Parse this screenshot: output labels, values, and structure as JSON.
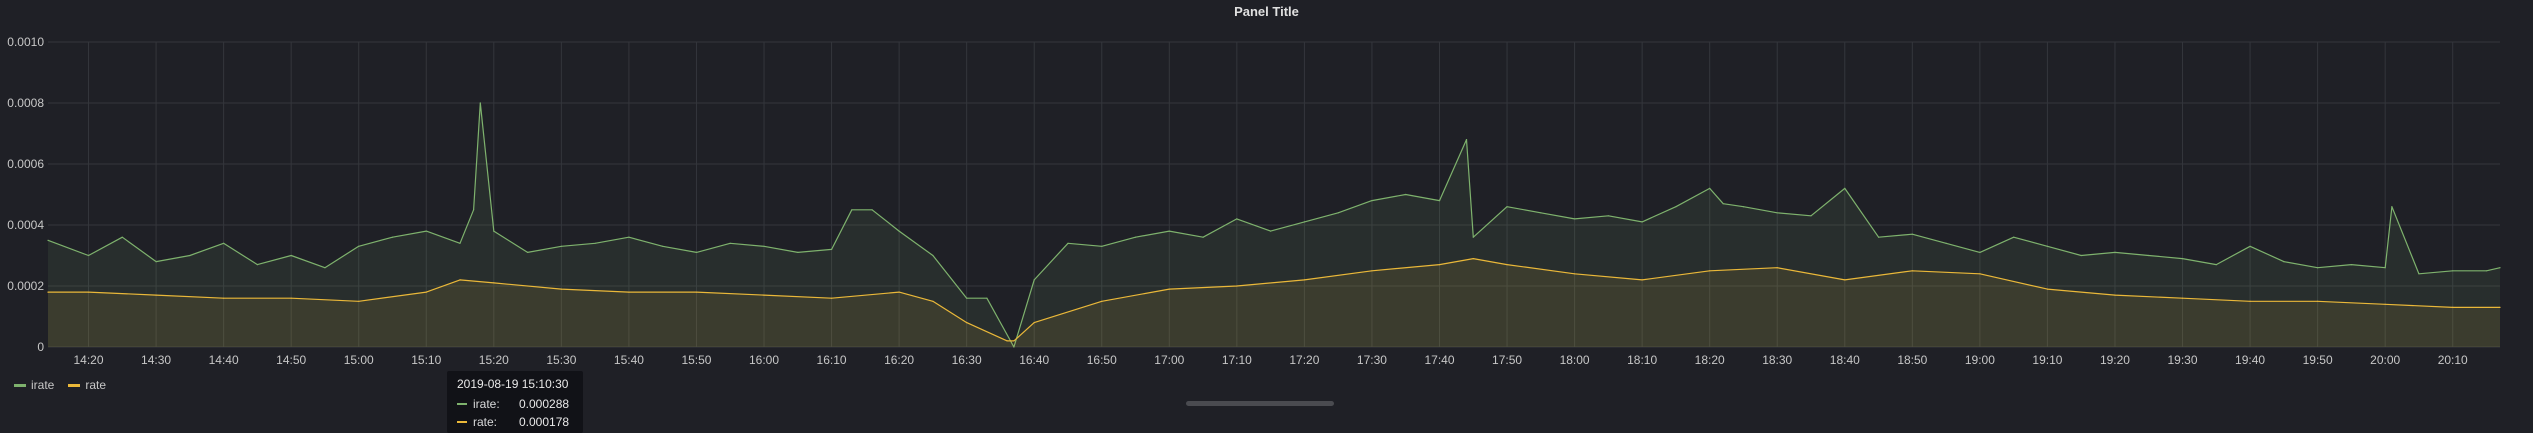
{
  "panel": {
    "title": "Panel Title"
  },
  "tooltip": {
    "time": "2019-08-19 15:10:30",
    "rows": [
      {
        "name": "irate:",
        "value": "0.000288",
        "color": "#7eb26d"
      },
      {
        "name": "rate:",
        "value": "0.000178",
        "color": "#eab839"
      }
    ]
  },
  "chart_data": {
    "type": "line",
    "title": "Panel Title",
    "xlabel": "",
    "ylabel": "",
    "x_domain": [
      "14:14",
      "20:17"
    ],
    "ylim": [
      0,
      0.001
    ],
    "yticks": [
      0,
      0.0002,
      0.0004,
      0.0006,
      0.0008,
      0.001
    ],
    "ytick_labels": [
      "0",
      "0.0002",
      "0.0004",
      "0.0006",
      "0.0008",
      "0.0010"
    ],
    "xticks": [
      "14:20",
      "14:30",
      "14:40",
      "14:50",
      "15:00",
      "15:10",
      "15:20",
      "15:30",
      "15:40",
      "15:50",
      "16:00",
      "16:10",
      "16:20",
      "16:30",
      "16:40",
      "16:50",
      "17:00",
      "17:10",
      "17:20",
      "17:30",
      "17:40",
      "17:50",
      "18:00",
      "18:10",
      "18:20",
      "18:30",
      "18:40",
      "18:50",
      "19:00",
      "19:10",
      "19:20",
      "19:30",
      "19:40",
      "19:50",
      "20:00",
      "20:10"
    ],
    "grid": true,
    "legend": "bottom-left",
    "series": [
      {
        "name": "irate",
        "color": "#7eb26d",
        "x": [
          "14:14",
          "14:20",
          "14:25",
          "14:30",
          "14:35",
          "14:40",
          "14:45",
          "14:50",
          "14:55",
          "15:00",
          "15:05",
          "15:10",
          "15:15",
          "15:17",
          "15:18",
          "15:20",
          "15:25",
          "15:30",
          "15:35",
          "15:40",
          "15:45",
          "15:50",
          "15:55",
          "16:00",
          "16:05",
          "16:10",
          "16:13",
          "16:16",
          "16:20",
          "16:25",
          "16:30",
          "16:33",
          "16:37",
          "16:40",
          "16:45",
          "16:50",
          "16:55",
          "17:00",
          "17:05",
          "17:10",
          "17:15",
          "17:20",
          "17:25",
          "17:30",
          "17:35",
          "17:40",
          "17:44",
          "17:45",
          "17:50",
          "17:55",
          "18:00",
          "18:05",
          "18:10",
          "18:15",
          "18:20",
          "18:22",
          "18:25",
          "18:30",
          "18:35",
          "18:40",
          "18:45",
          "18:50",
          "18:55",
          "19:00",
          "19:05",
          "19:10",
          "19:15",
          "19:20",
          "19:25",
          "19:30",
          "19:35",
          "19:40",
          "19:45",
          "19:50",
          "19:55",
          "20:00",
          "20:01",
          "20:05",
          "20:10",
          "20:15",
          "20:17"
        ],
        "values": [
          0.00035,
          0.0003,
          0.00036,
          0.00028,
          0.0003,
          0.00034,
          0.00027,
          0.0003,
          0.00026,
          0.00033,
          0.00036,
          0.00038,
          0.00034,
          0.00045,
          0.0008,
          0.00038,
          0.00031,
          0.00033,
          0.00034,
          0.00036,
          0.00033,
          0.00031,
          0.00034,
          0.00033,
          0.00031,
          0.00032,
          0.00045,
          0.00045,
          0.00038,
          0.0003,
          0.00016,
          0.00016,
          0.0,
          0.00022,
          0.00034,
          0.00033,
          0.00036,
          0.00038,
          0.00036,
          0.00042,
          0.00038,
          0.00041,
          0.00044,
          0.00048,
          0.0005,
          0.00048,
          0.00068,
          0.00036,
          0.00046,
          0.00044,
          0.00042,
          0.00043,
          0.00041,
          0.00046,
          0.00052,
          0.00047,
          0.00046,
          0.00044,
          0.00043,
          0.00052,
          0.00036,
          0.00037,
          0.00034,
          0.00031,
          0.00036,
          0.00033,
          0.0003,
          0.00031,
          0.0003,
          0.00029,
          0.00027,
          0.00033,
          0.00028,
          0.00026,
          0.00027,
          0.00026,
          0.00046,
          0.00024,
          0.00025,
          0.00025,
          0.00026
        ]
      },
      {
        "name": "rate",
        "color": "#eab839",
        "x": [
          "14:14",
          "14:20",
          "14:30",
          "14:40",
          "14:50",
          "15:00",
          "15:10",
          "15:15",
          "15:20",
          "15:30",
          "15:40",
          "15:50",
          "16:00",
          "16:10",
          "16:20",
          "16:25",
          "16:30",
          "16:36",
          "16:37",
          "16:40",
          "16:50",
          "17:00",
          "17:10",
          "17:20",
          "17:30",
          "17:40",
          "17:45",
          "17:50",
          "18:00",
          "18:10",
          "18:20",
          "18:30",
          "18:40",
          "18:50",
          "19:00",
          "19:10",
          "19:20",
          "19:30",
          "19:40",
          "19:50",
          "20:00",
          "20:10",
          "20:17"
        ],
        "values": [
          0.00018,
          0.00018,
          0.00017,
          0.00016,
          0.00016,
          0.00015,
          0.00018,
          0.00022,
          0.00021,
          0.00019,
          0.00018,
          0.00018,
          0.00017,
          0.00016,
          0.00018,
          0.00015,
          8e-05,
          2e-05,
          2e-05,
          8e-05,
          0.00015,
          0.00019,
          0.0002,
          0.00022,
          0.00025,
          0.00027,
          0.00029,
          0.00027,
          0.00024,
          0.00022,
          0.00025,
          0.00026,
          0.00022,
          0.00025,
          0.00024,
          0.00019,
          0.00017,
          0.00016,
          0.00015,
          0.00015,
          0.00014,
          0.00013,
          0.00013
        ]
      }
    ]
  }
}
